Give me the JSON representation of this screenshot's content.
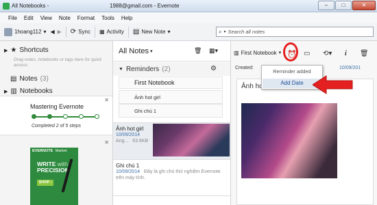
{
  "window": {
    "title_left": "All Notebooks -",
    "title_center": "1988@gmail.com - Evernote",
    "min": "–",
    "max": "□",
    "close": "✕"
  },
  "menu": [
    "File",
    "Edit",
    "View",
    "Note",
    "Format",
    "Tools",
    "Help"
  ],
  "toolbar": {
    "user": "1hoang112",
    "sync": "Sync",
    "activity": "Activity",
    "new_note": "New Note",
    "search_placeholder": "Search all notes"
  },
  "sidebar": {
    "shortcuts": "Shortcuts",
    "shortcuts_hint": "Drag notes, notebooks or tags here for quick access",
    "notes": "Notes",
    "notes_count": "(3)",
    "notebooks": "Notebooks",
    "mastering": "Mastering Evernote",
    "steps_done": 2,
    "steps_total": 5,
    "completed": "Completed 2 of 5 steps",
    "ad": {
      "brand": "EVERNOTE",
      "brand_sub": "Market",
      "headline1": "WRITE",
      "headline1b": "with",
      "headline2": "PRECISION",
      "cta": "SHOP ›"
    }
  },
  "notelist": {
    "title": "All Notes",
    "reminders": "Reminders",
    "reminders_count": "(2)",
    "rows": [
      "First Notebook",
      "Ảnh hot girl",
      "Ghi chú 1"
    ],
    "cards": [
      {
        "title": "Ảnh hot girl",
        "date": "10/09/2014",
        "meta1": "Ang...",
        "size": "63.6KB"
      },
      {
        "title": "Ghi chú 1",
        "date": "10/09/2014",
        "text": "Đây là ghi chú thử nghiệm Evernote trên máy tính."
      }
    ]
  },
  "editor": {
    "notebook": "First Notebook",
    "created_label": "Created:",
    "date_right": "10/09/201",
    "note_title": "Ảnh hot girl",
    "popup": {
      "label": "Reminder added",
      "button": "Add Date"
    }
  },
  "colors": {
    "highlight": "#e52020",
    "link": "#3a6ea5",
    "green": "#2f8a3a"
  }
}
